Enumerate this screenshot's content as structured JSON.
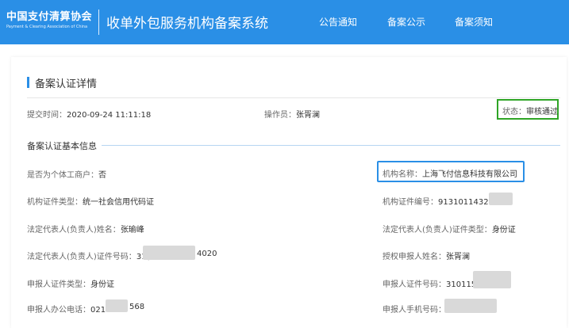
{
  "header": {
    "logo_cn": "中国支付清算协会",
    "logo_en": "Payment & Clearing Association of China",
    "system_title": "收单外包服务机构备案系统",
    "nav": [
      "公告通知",
      "备案公示",
      "备案须知"
    ]
  },
  "panel": {
    "title": "备案认证详情",
    "submit_time_label": "提交时间：",
    "submit_time_value": "2020-09-24 11:11:18",
    "operator_label": "操作员：",
    "operator_value": "张胥澜",
    "status_label": "状态：",
    "status_value": "审核通过"
  },
  "basic_info": {
    "section_title": "备案认证基本信息",
    "individual_label": "是否为个体工商户：",
    "individual_value": "否",
    "org_name_label": "机构名称：",
    "org_name_value": "上海飞付信息科技有限公司",
    "cert_type_label": "机构证件类型：",
    "cert_type_value": "统一社会信用代码证",
    "cert_no_label": "机构证件编号：",
    "cert_no_value": "913101143208",
    "legal_name_label": "法定代表人(负责人)姓名：",
    "legal_name_value": "张瑜峰",
    "legal_id_type_label": "法定代表人(负责人)证件类型：",
    "legal_id_type_value": "身份证",
    "legal_id_no_label": "法定代表人(负责人)证件号码：",
    "legal_id_no_prefix": "31(",
    "legal_id_no_suffix": "4020",
    "auth_applicant_label": "授权申报人姓名：",
    "auth_applicant_value": "张胥澜",
    "applicant_id_type_label": "申报人证件类型：",
    "applicant_id_type_value": "身份证",
    "applicant_id_no_label": "申报人证件号码：",
    "applicant_id_no_value": "310115",
    "office_phone_label": "申报人办公电话：",
    "office_phone_prefix": "021-",
    "office_phone_suffix": "568",
    "mobile_label": "申报人手机号码："
  },
  "colors": {
    "header_bg": "#2a8fe6",
    "status_border": "#2fa526",
    "highlight_border": "#2a8fe6"
  }
}
